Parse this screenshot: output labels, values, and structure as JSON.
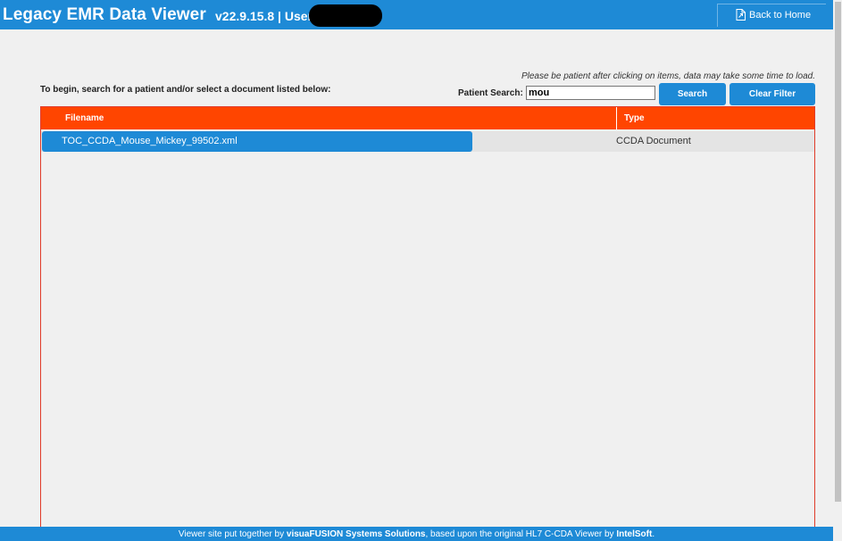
{
  "header": {
    "app_title": "Legacy EMR Data Viewer",
    "version_user": "v22.9.15.8 | User:",
    "back_home_label": "Back to Home",
    "back_home_icon": "document-link-icon"
  },
  "search": {
    "notice": "Please be patient after clicking on items, data may take some time to load.",
    "instructions": "To begin, search for a patient and/or select a document listed below:",
    "label": "Patient Search:",
    "value": "mou",
    "search_button": "Search",
    "clear_button": "Clear Filter"
  },
  "table": {
    "columns": [
      "Filename",
      "Type"
    ],
    "rows": [
      {
        "filename": "TOC_CCDA_Mouse_Mickey_99502.xml",
        "type": "CCDA Document"
      }
    ]
  },
  "footer": {
    "prefix": "Viewer site put together by ",
    "company": "visuaFUSION Systems Solutions",
    "middle": ", based upon the original HL7 C-CDA Viewer by ",
    "original_author": "IntelSoft",
    "suffix": "."
  },
  "colors": {
    "primary": "#1e8ad6",
    "table_header": "#ff4500",
    "table_border": "#e03c2a",
    "background": "#f0f0f0"
  }
}
